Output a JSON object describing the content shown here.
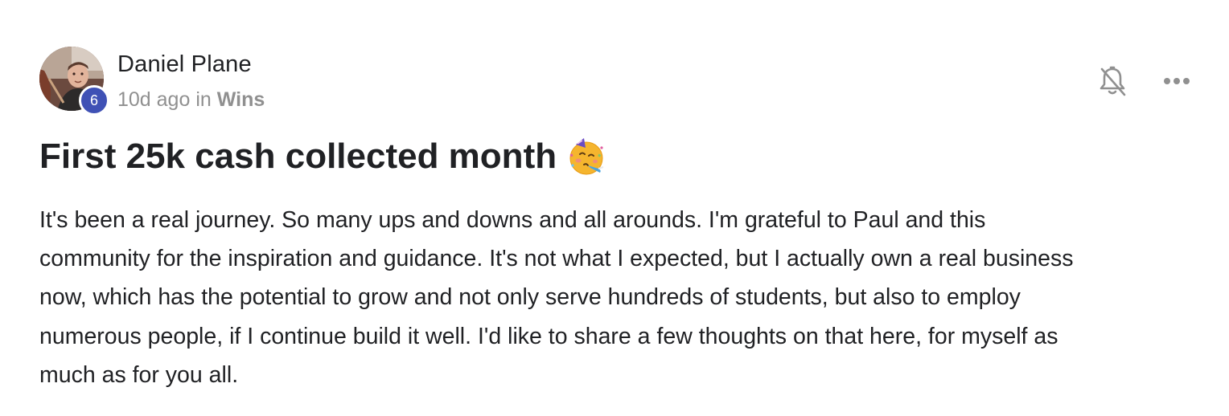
{
  "author": {
    "name": "Daniel Plane",
    "level": "6",
    "avatar_icon": "avatar-photo"
  },
  "meta": {
    "time": "10d ago",
    "in_word": "in",
    "category": "Wins"
  },
  "actions": {
    "notify_icon": "bell-off-icon",
    "more_icon": "more-horizontal-icon"
  },
  "post": {
    "title": "First 25k cash collected month",
    "title_emoji": "partying-face-emoji",
    "body": "It's been a real journey. So many ups and downs and all arounds. I'm grateful to Paul and this\ncommunity for the inspiration and guidance. It's not what I expected, but I actually own a real business\nnow, which has the potential to grow and not only serve hundreds of students, but also to employ\nnumerous people, if I continue build it well. I'd like to share a few thoughts on that here, for myself as\nmuch as for you all."
  },
  "colors": {
    "badge": "#3f51b5",
    "text": "#202124",
    "muted": "#909090",
    "icon": "#909090"
  }
}
